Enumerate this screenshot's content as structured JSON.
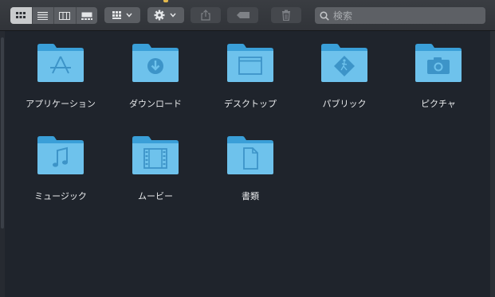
{
  "toolbar": {
    "view_modes": [
      "icon-view",
      "list-view",
      "column-view",
      "gallery-view"
    ],
    "active_view": "icon-view",
    "group_button_icon": "grid-icon",
    "action_button_icon": "gear-icon",
    "share_button_icon": "share-icon",
    "tag_button_icon": "tag-icon",
    "trash_button_icon": "trash-icon"
  },
  "search": {
    "placeholder": "検索"
  },
  "folders": [
    {
      "label": "アプリケーション",
      "icon": "app-store-folder-icon"
    },
    {
      "label": "ダウンロード",
      "icon": "download-folder-icon"
    },
    {
      "label": "デスクトップ",
      "icon": "desktop-folder-icon"
    },
    {
      "label": "パブリック",
      "icon": "public-folder-icon"
    },
    {
      "label": "ピクチャ",
      "icon": "camera-folder-icon"
    },
    {
      "label": "ミュージック",
      "icon": "music-folder-icon"
    },
    {
      "label": "ムービー",
      "icon": "movie-folder-icon"
    },
    {
      "label": "書類",
      "icon": "document-folder-icon"
    }
  ],
  "colors": {
    "background": "#1f242c",
    "folder_light": "#7ccaf0",
    "folder_dark": "#3a9fd8",
    "label_text": "#e8eaec"
  }
}
